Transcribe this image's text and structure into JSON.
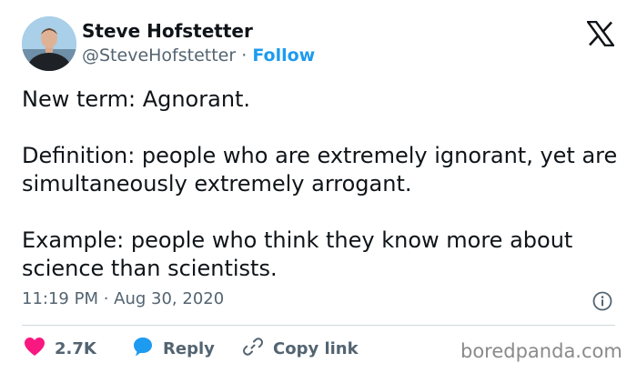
{
  "author": {
    "display_name": "Steve Hofstetter",
    "handle": "@SteveHofstetter",
    "separator": " · ",
    "follow_label": "Follow",
    "avatar_icon": "person-avatar"
  },
  "platform_logo": "x-logo",
  "tweet": {
    "paragraphs": [
      "New term: Agnorant.",
      "Definition: people who are extremely ignorant, yet are simultaneously extremely arrogant.",
      "Example: people who think they know more about science than scientists."
    ],
    "timestamp": "11:19 PM · Aug 30, 2020"
  },
  "actions": {
    "like_count": "2.7K",
    "reply_label": "Reply",
    "copy_link_label": "Copy link"
  },
  "watermark": "boredpanda.com",
  "colors": {
    "accent": "#1d9bf0",
    "like": "#f91880",
    "text": "#0f1419",
    "muted": "#536471"
  }
}
